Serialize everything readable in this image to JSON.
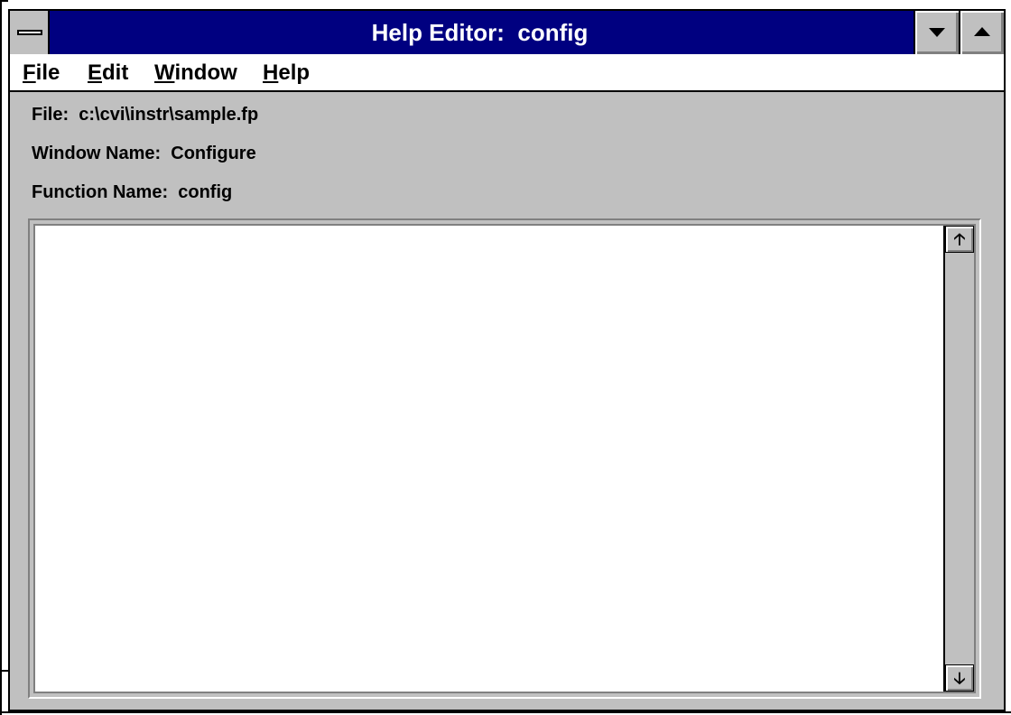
{
  "window": {
    "title": "Help Editor:  config"
  },
  "menu": {
    "items": [
      {
        "first": "F",
        "rest": "ile"
      },
      {
        "first": "E",
        "rest": "dit"
      },
      {
        "first": "W",
        "rest": "indow"
      },
      {
        "first": "H",
        "rest": "elp"
      }
    ]
  },
  "info": {
    "file": "File:  c:\\cvi\\instr\\sample.fp",
    "window_name": "Window Name:  Configure",
    "function_name": "Function Name:  config"
  },
  "editor": {
    "text": ""
  },
  "icons": {
    "system_menu": "system-menu-icon",
    "minimize": "minimize-icon",
    "maximize": "maximize-icon",
    "scroll_up": "scroll-up-arrow-icon",
    "scroll_down": "scroll-down-arrow-icon"
  },
  "colors": {
    "titlebar": "#000080",
    "face": "#c0c0c0",
    "editor": "#ffffff"
  }
}
